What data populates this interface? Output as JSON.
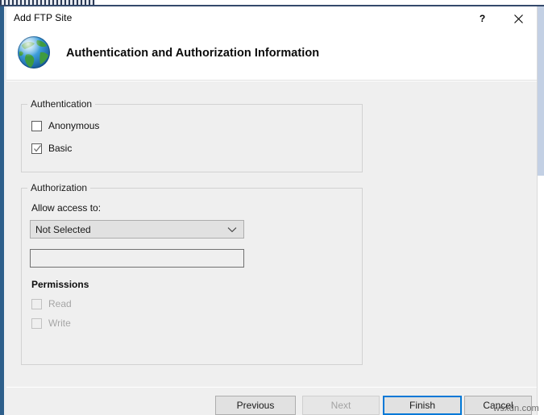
{
  "window": {
    "title": "Add FTP Site",
    "help_label": "?",
    "close_label": "✕",
    "icons": {
      "help": "question-mark-icon",
      "close": "close-icon",
      "app": "globe-icon"
    }
  },
  "header": {
    "title": "Authentication and Authorization Information"
  },
  "authentication": {
    "legend": "Authentication",
    "options": [
      {
        "label": "Anonymous",
        "checked": false,
        "disabled": false
      },
      {
        "label": "Basic",
        "checked": true,
        "disabled": false
      }
    ]
  },
  "authorization": {
    "legend": "Authorization",
    "allow_access_label": "Allow access to:",
    "allow_access_value": "Not Selected",
    "allow_access_options": [
      "Not Selected"
    ],
    "users_value": "",
    "users_placeholder": "",
    "permissions_label": "Permissions",
    "permissions": [
      {
        "label": "Read",
        "checked": false,
        "disabled": true
      },
      {
        "label": "Write",
        "checked": false,
        "disabled": true
      }
    ]
  },
  "footer": {
    "previous": "Previous",
    "next": "Next",
    "finish": "Finish",
    "cancel": "Cancel"
  },
  "watermark": "wsxdn.com",
  "colors": {
    "accent": "#0078d7",
    "dialog_bg": "#efefef",
    "titlebar_bg": "#ffffff",
    "text": "#111111",
    "disabled_text": "#a6a6a6"
  }
}
